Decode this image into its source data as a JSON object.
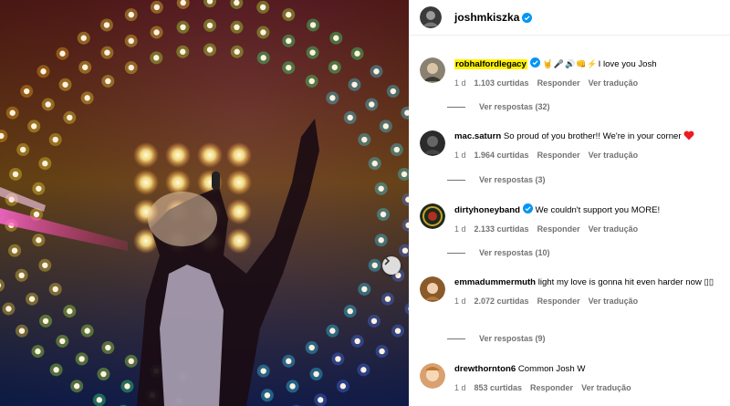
{
  "post": {
    "username": "joshmkiszka"
  },
  "comments": [
    {
      "username": "robhalfordlegacy",
      "verified": true,
      "text": "I love you Josh",
      "emojis": [
        "🤘",
        "🎤",
        "🔊",
        "👊",
        "⚡"
      ],
      "age": "1 d",
      "likes": "1.103 curtidas",
      "reply_label": "Responder",
      "translate_label": "Ver tradução",
      "replies_label": "Ver respostas (32)"
    },
    {
      "username": "mac.saturn",
      "verified": false,
      "text": "So proud of you brother!! We're in your corner",
      "age": "1 d",
      "likes": "1.964 curtidas",
      "reply_label": "Responder",
      "translate_label": "Ver tradução",
      "replies_label": "Ver respostas (3)"
    },
    {
      "username": "dirtyhoneyband",
      "verified": true,
      "text": "We couldn't support you MORE!",
      "age": "1 d",
      "likes": "2.133 curtidas",
      "reply_label": "Responder",
      "translate_label": "Ver tradução",
      "replies_label": "Ver respostas (10)"
    },
    {
      "username": "emmadummermuth",
      "verified": false,
      "text": "light my love is gonna hit even harder now",
      "age": "1 d",
      "likes": "2.072 curtidas",
      "reply_label": "Responder",
      "translate_label": "Ver tradução",
      "replies_label": "Ver respostas (9)"
    },
    {
      "username": "drewthornton6",
      "verified": false,
      "text": "Common Josh W",
      "age": "1 d",
      "likes": "853 curtidas",
      "reply_label": "Responder",
      "translate_label": "Ver tradução"
    }
  ],
  "colors": {
    "verified": "#0095f6",
    "heart": "#ed1c24",
    "highlight": "#fff200",
    "muted": "#737373"
  }
}
